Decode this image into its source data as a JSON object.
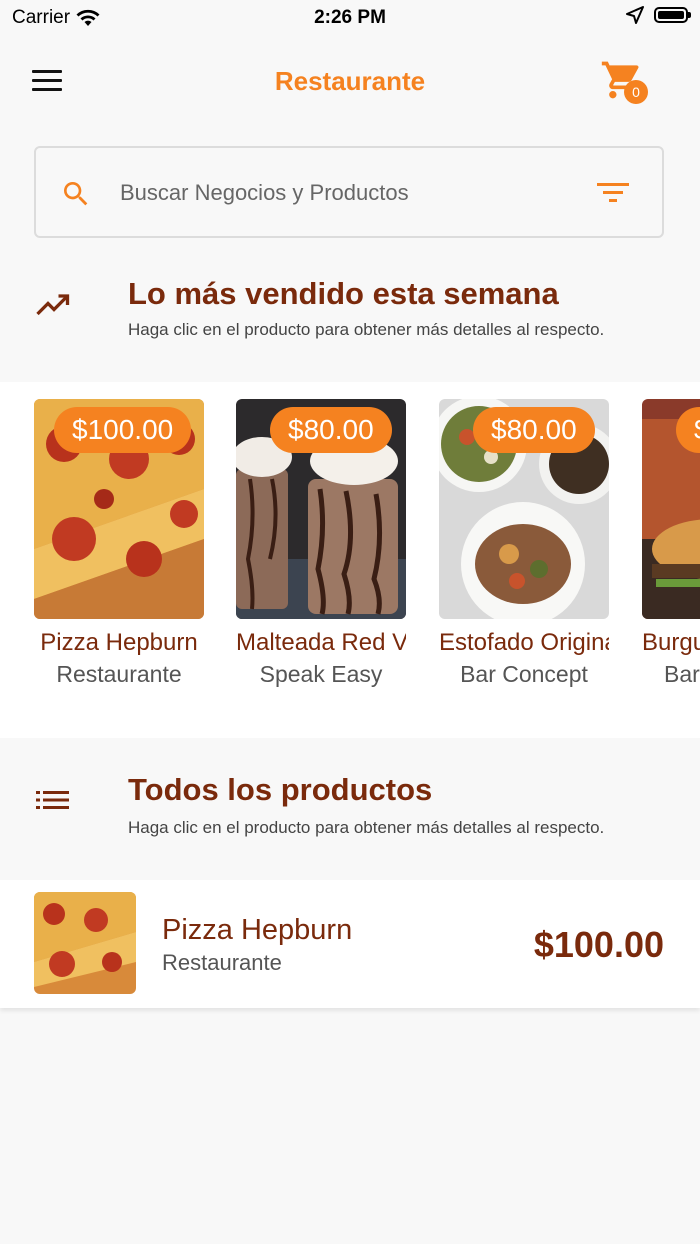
{
  "status_bar": {
    "carrier": "Carrier",
    "time": "2:26 PM"
  },
  "header": {
    "title": "Restaurante",
    "cart_count": "0"
  },
  "search": {
    "placeholder": "Buscar Negocios y Productos",
    "value": ""
  },
  "best_sellers": {
    "title": "Lo más vendido esta semana",
    "subtitle": "Haga clic en el producto para obtener más detalles al respecto.",
    "items": [
      {
        "name": "Pizza Hepburn",
        "business": "Restaurante",
        "price": "$100.00",
        "image": "pizza"
      },
      {
        "name": "Malteada Red Ve",
        "business": "Speak Easy",
        "price": "$80.00",
        "image": "milkshake"
      },
      {
        "name": "Estofado Origina",
        "business": "Bar Concept",
        "price": "$80.00",
        "image": "stew"
      },
      {
        "name": "Burgu",
        "business": "Bar",
        "price": "$",
        "image": "burger"
      }
    ]
  },
  "all_products": {
    "title": "Todos los productos",
    "subtitle": "Haga clic en el producto para obtener más detalles al respecto.",
    "items": [
      {
        "name": "Pizza Hepburn",
        "business": "Restaurante",
        "price": "$100.00",
        "image": "pizza"
      }
    ]
  },
  "colors": {
    "accent": "#f58220",
    "title_brown": "#7a2a0c"
  }
}
